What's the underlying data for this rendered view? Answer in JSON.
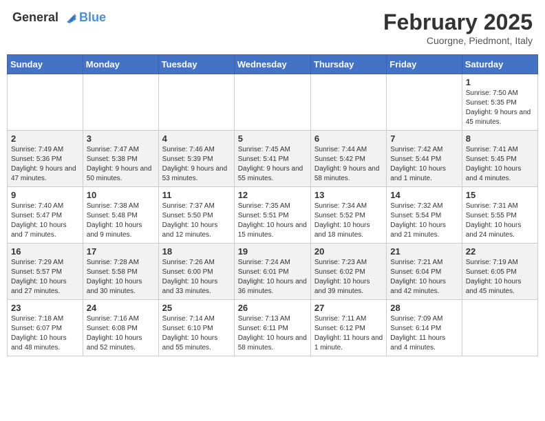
{
  "logo": {
    "general": "General",
    "blue": "Blue"
  },
  "title": "February 2025",
  "subtitle": "Cuorgne, Piedmont, Italy",
  "weekdays": [
    "Sunday",
    "Monday",
    "Tuesday",
    "Wednesday",
    "Thursday",
    "Friday",
    "Saturday"
  ],
  "weeks": [
    [
      {
        "day": "",
        "info": ""
      },
      {
        "day": "",
        "info": ""
      },
      {
        "day": "",
        "info": ""
      },
      {
        "day": "",
        "info": ""
      },
      {
        "day": "",
        "info": ""
      },
      {
        "day": "",
        "info": ""
      },
      {
        "day": "1",
        "info": "Sunrise: 7:50 AM\nSunset: 5:35 PM\nDaylight: 9 hours and 45 minutes."
      }
    ],
    [
      {
        "day": "2",
        "info": "Sunrise: 7:49 AM\nSunset: 5:36 PM\nDaylight: 9 hours and 47 minutes."
      },
      {
        "day": "3",
        "info": "Sunrise: 7:47 AM\nSunset: 5:38 PM\nDaylight: 9 hours and 50 minutes."
      },
      {
        "day": "4",
        "info": "Sunrise: 7:46 AM\nSunset: 5:39 PM\nDaylight: 9 hours and 53 minutes."
      },
      {
        "day": "5",
        "info": "Sunrise: 7:45 AM\nSunset: 5:41 PM\nDaylight: 9 hours and 55 minutes."
      },
      {
        "day": "6",
        "info": "Sunrise: 7:44 AM\nSunset: 5:42 PM\nDaylight: 9 hours and 58 minutes."
      },
      {
        "day": "7",
        "info": "Sunrise: 7:42 AM\nSunset: 5:44 PM\nDaylight: 10 hours and 1 minute."
      },
      {
        "day": "8",
        "info": "Sunrise: 7:41 AM\nSunset: 5:45 PM\nDaylight: 10 hours and 4 minutes."
      }
    ],
    [
      {
        "day": "9",
        "info": "Sunrise: 7:40 AM\nSunset: 5:47 PM\nDaylight: 10 hours and 7 minutes."
      },
      {
        "day": "10",
        "info": "Sunrise: 7:38 AM\nSunset: 5:48 PM\nDaylight: 10 hours and 9 minutes."
      },
      {
        "day": "11",
        "info": "Sunrise: 7:37 AM\nSunset: 5:50 PM\nDaylight: 10 hours and 12 minutes."
      },
      {
        "day": "12",
        "info": "Sunrise: 7:35 AM\nSunset: 5:51 PM\nDaylight: 10 hours and 15 minutes."
      },
      {
        "day": "13",
        "info": "Sunrise: 7:34 AM\nSunset: 5:52 PM\nDaylight: 10 hours and 18 minutes."
      },
      {
        "day": "14",
        "info": "Sunrise: 7:32 AM\nSunset: 5:54 PM\nDaylight: 10 hours and 21 minutes."
      },
      {
        "day": "15",
        "info": "Sunrise: 7:31 AM\nSunset: 5:55 PM\nDaylight: 10 hours and 24 minutes."
      }
    ],
    [
      {
        "day": "16",
        "info": "Sunrise: 7:29 AM\nSunset: 5:57 PM\nDaylight: 10 hours and 27 minutes."
      },
      {
        "day": "17",
        "info": "Sunrise: 7:28 AM\nSunset: 5:58 PM\nDaylight: 10 hours and 30 minutes."
      },
      {
        "day": "18",
        "info": "Sunrise: 7:26 AM\nSunset: 6:00 PM\nDaylight: 10 hours and 33 minutes."
      },
      {
        "day": "19",
        "info": "Sunrise: 7:24 AM\nSunset: 6:01 PM\nDaylight: 10 hours and 36 minutes."
      },
      {
        "day": "20",
        "info": "Sunrise: 7:23 AM\nSunset: 6:02 PM\nDaylight: 10 hours and 39 minutes."
      },
      {
        "day": "21",
        "info": "Sunrise: 7:21 AM\nSunset: 6:04 PM\nDaylight: 10 hours and 42 minutes."
      },
      {
        "day": "22",
        "info": "Sunrise: 7:19 AM\nSunset: 6:05 PM\nDaylight: 10 hours and 45 minutes."
      }
    ],
    [
      {
        "day": "23",
        "info": "Sunrise: 7:18 AM\nSunset: 6:07 PM\nDaylight: 10 hours and 48 minutes."
      },
      {
        "day": "24",
        "info": "Sunrise: 7:16 AM\nSunset: 6:08 PM\nDaylight: 10 hours and 52 minutes."
      },
      {
        "day": "25",
        "info": "Sunrise: 7:14 AM\nSunset: 6:10 PM\nDaylight: 10 hours and 55 minutes."
      },
      {
        "day": "26",
        "info": "Sunrise: 7:13 AM\nSunset: 6:11 PM\nDaylight: 10 hours and 58 minutes."
      },
      {
        "day": "27",
        "info": "Sunrise: 7:11 AM\nSunset: 6:12 PM\nDaylight: 11 hours and 1 minute."
      },
      {
        "day": "28",
        "info": "Sunrise: 7:09 AM\nSunset: 6:14 PM\nDaylight: 11 hours and 4 minutes."
      },
      {
        "day": "",
        "info": ""
      }
    ]
  ]
}
